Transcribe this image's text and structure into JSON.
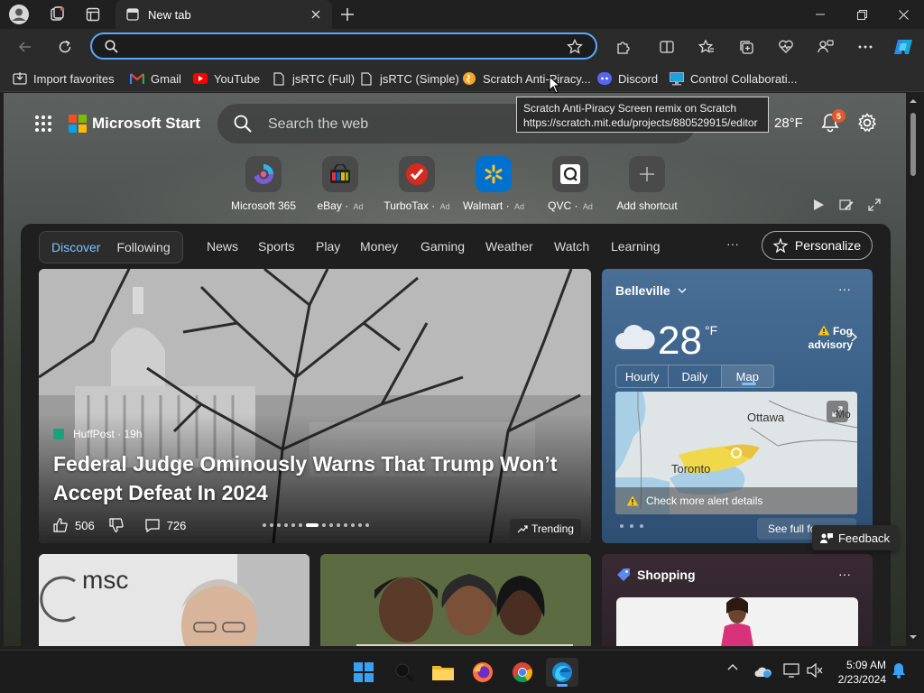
{
  "window": {
    "tab_title": "New tab"
  },
  "toolbar": {
    "address_value": "",
    "address_placeholder": ""
  },
  "bookmarks": [
    {
      "label": "Import favorites",
      "icon": "import-icon"
    },
    {
      "label": "Gmail",
      "icon": "gmail-icon"
    },
    {
      "label": "YouTube",
      "icon": "youtube-icon"
    },
    {
      "label": "jsRTC (Full)",
      "icon": "page-icon"
    },
    {
      "label": "jsRTC (Simple)",
      "icon": "page-icon"
    },
    {
      "label": "Scratch Anti-Piracy...",
      "icon": "scratch-icon"
    },
    {
      "label": "Discord",
      "icon": "discord-icon"
    },
    {
      "label": "Control Collaborati...",
      "icon": "monitor-icon"
    }
  ],
  "tooltip": {
    "line1": "Scratch Anti-Piracy Screen remix on Scratch",
    "line2": "https://scratch.mit.edu/projects/880529915/editor"
  },
  "start": {
    "brand": "Microsoft Start",
    "search_placeholder": "Search the web",
    "temperature": "28°F",
    "notification_count": "5"
  },
  "shortcuts": [
    {
      "label": "Microsoft 365",
      "ad": ""
    },
    {
      "label": "eBay",
      "ad": "Ad"
    },
    {
      "label": "TurboTax",
      "ad": "Ad"
    },
    {
      "label": "Walmart",
      "ad": "Ad"
    },
    {
      "label": "QVC",
      "ad": "Ad"
    },
    {
      "label": "Add shortcut",
      "ad": ""
    }
  ],
  "nav": {
    "discover": "Discover",
    "following": "Following",
    "links": [
      "News",
      "Sports",
      "Play",
      "Money",
      "Gaming",
      "Weather",
      "Watch",
      "Learning"
    ],
    "more": "···",
    "personalize": "Personalize"
  },
  "hero": {
    "source": "HuffPost · 19h",
    "title": "Federal Judge Ominously Warns That Trump Won’t Accept Defeat In 2024",
    "likes": "506",
    "comments": "726",
    "trending": "Trending",
    "slide_count": 14,
    "active_slide": 6
  },
  "weather": {
    "location": "Belleville",
    "temperature": "28",
    "unit": "°F",
    "alert": "Fog advisory",
    "tabs": [
      "Hourly",
      "Daily",
      "Map"
    ],
    "selected_tab": "Map",
    "map_labels": [
      "Ottawa",
      "Toronto",
      "Mo"
    ],
    "map_alert": "Check more alert details",
    "forecast_button": "See full forecast",
    "more": "···"
  },
  "cards": {
    "shopping_title": "Shopping",
    "more": "···"
  },
  "feedback": "Feedback",
  "taskbar": {
    "time": "5:09 AM",
    "date": "2/23/2024"
  }
}
